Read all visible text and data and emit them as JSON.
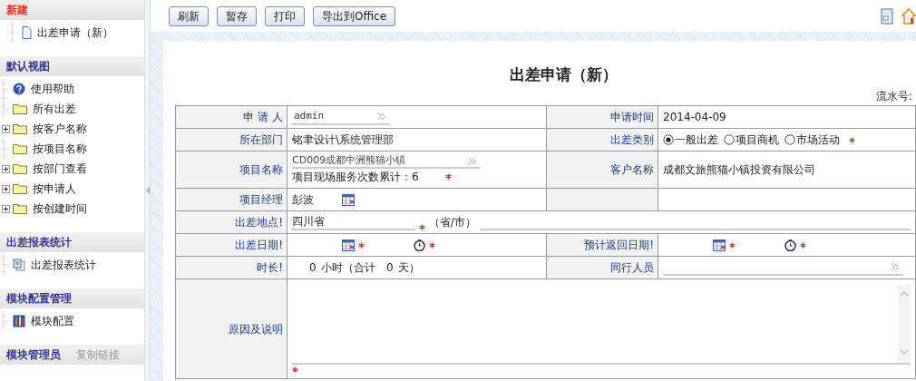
{
  "sidebar": {
    "sections": [
      {
        "title": "新建",
        "color": "#ff3300",
        "items": [
          {
            "label": "出差申请（新）",
            "kind": "document",
            "expandable": false
          }
        ]
      },
      {
        "title": "默认视图",
        "color": "#333399",
        "items": [
          {
            "label": "使用帮助",
            "kind": "help",
            "expandable": false
          },
          {
            "label": "所有出差",
            "kind": "folder",
            "expandable": false
          },
          {
            "label": "按客户名称",
            "kind": "folder",
            "expandable": true
          },
          {
            "label": "按项目名称",
            "kind": "folder",
            "expandable": false
          },
          {
            "label": "按部门查看",
            "kind": "folder",
            "expandable": true
          },
          {
            "label": "按申请人",
            "kind": "folder",
            "expandable": true
          },
          {
            "label": "按创建时间",
            "kind": "folder",
            "expandable": true
          }
        ]
      },
      {
        "title": "出差报表统计",
        "color": "#333399",
        "items": [
          {
            "label": "出差报表统计",
            "kind": "report",
            "expandable": false
          }
        ]
      },
      {
        "title": "模块配置管理",
        "color": "#333399",
        "items": [
          {
            "label": "模块配置",
            "kind": "config",
            "expandable": false
          }
        ]
      },
      {
        "title": "模块管理员",
        "color": "#333399",
        "link": "复制链接"
      }
    ]
  },
  "toolbar": {
    "buttons": [
      "刷新",
      "暂存",
      "打印",
      "导出到Office"
    ]
  },
  "form": {
    "title": "出差申请（新）",
    "serial_label": "流水号:",
    "rows": [
      {
        "cells": [
          {
            "label": "申 请 人",
            "kind": "picker",
            "value": "admin"
          },
          {
            "label": "申请时间",
            "kind": "text",
            "value": "2014-04-09"
          }
        ]
      },
      {
        "cells": [
          {
            "label": "所在部门",
            "kind": "text",
            "value": "铭聿设计\\系统管理部"
          },
          {
            "label": "出差类别",
            "kind": "radio",
            "required": true,
            "options": [
              {
                "label": "一般出差",
                "selected": true
              },
              {
                "label": "项目商机",
                "selected": false
              },
              {
                "label": "市场活动",
                "selected": false
              }
            ]
          }
        ]
      },
      {
        "cells": [
          {
            "label": "项目名称",
            "kind": "project",
            "value": "CD009成都中洲熊猫小镇",
            "note": "项目现场服务次数累计：6",
            "required": true
          },
          {
            "label": "客户名称",
            "kind": "text",
            "value": "成都文旅熊猫小镇投资有限公司"
          }
        ]
      },
      {
        "cells": [
          {
            "label": "项目经理",
            "kind": "person",
            "value": "彭波"
          },
          {
            "kind": "blank"
          }
        ]
      },
      {
        "cells": [
          {
            "label": "出差地点!",
            "kind": "location",
            "value": "四川省",
            "required": true,
            "suffix": "（省/市）"
          }
        ]
      },
      {
        "cells": [
          {
            "label": "出差日期!",
            "kind": "datetime",
            "required": true
          },
          {
            "label": "预计返回日期!",
            "kind": "datetime",
            "required": true
          }
        ]
      },
      {
        "cells": [
          {
            "label": "时长!",
            "kind": "duration",
            "hours": "0",
            "hours_unit": "小时（合计",
            "days": "0",
            "days_unit": "天）"
          },
          {
            "label": "同行人员",
            "kind": "picker"
          }
        ]
      },
      {
        "cells": [
          {
            "label": "原因及说明",
            "kind": "textarea",
            "required": true
          }
        ]
      }
    ]
  }
}
